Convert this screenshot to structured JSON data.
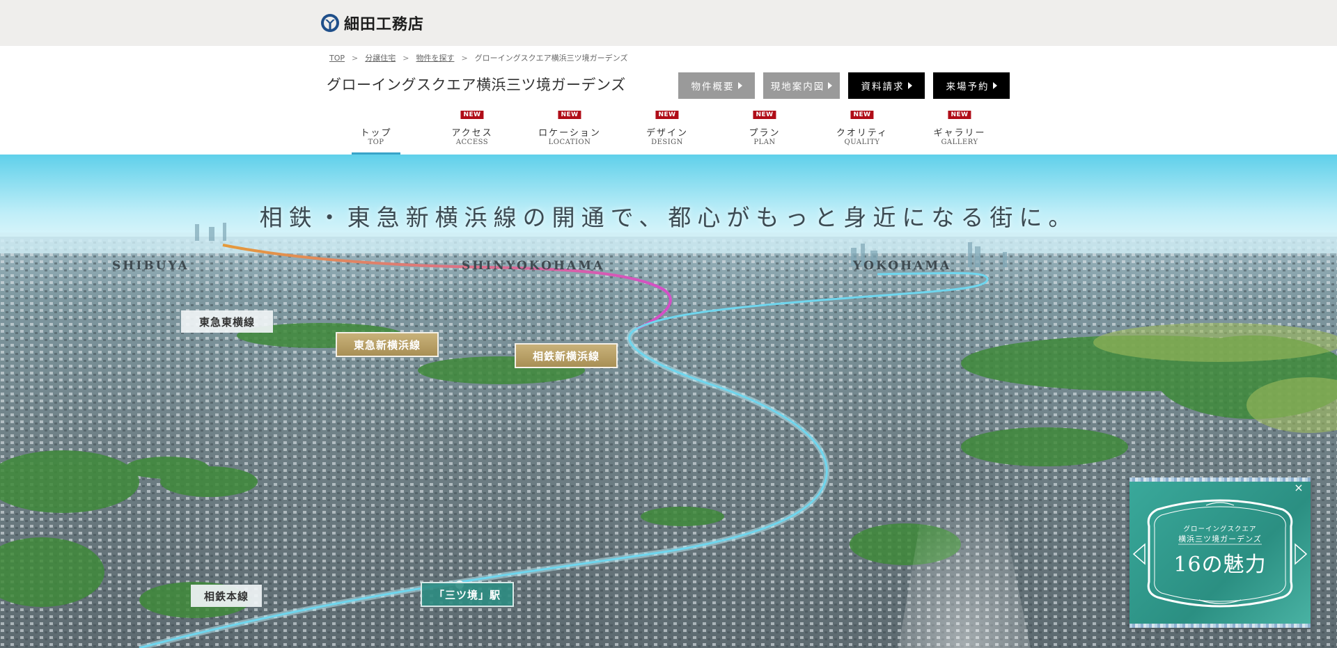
{
  "brand": {
    "name": "細田工務店"
  },
  "breadcrumb": {
    "items": [
      "TOP",
      "分譲住宅",
      "物件を探す",
      "グローイングスクエア横浜三ツ境ガーデンズ"
    ],
    "separator": ">"
  },
  "property": {
    "title": "グローイングスクエア横浜三ツ境ガーデンズ"
  },
  "header_buttons": {
    "overview": "物件概要",
    "map": "現地案内図",
    "request": "資料請求",
    "visit": "来場予約"
  },
  "nav": {
    "badge": "NEW",
    "items": [
      {
        "jp": "トップ",
        "en": "TOP",
        "is_new": false,
        "active": true
      },
      {
        "jp": "アクセス",
        "en": "ACCESS",
        "is_new": true,
        "active": false
      },
      {
        "jp": "ロケーション",
        "en": "LOCATION",
        "is_new": true,
        "active": false
      },
      {
        "jp": "デザイン",
        "en": "DESIGN",
        "is_new": true,
        "active": false
      },
      {
        "jp": "プラン",
        "en": "PLAN",
        "is_new": true,
        "active": false
      },
      {
        "jp": "クオリティ",
        "en": "QUALITY",
        "is_new": true,
        "active": false
      },
      {
        "jp": "ギャラリー",
        "en": "GALLERY",
        "is_new": true,
        "active": false
      }
    ]
  },
  "hero": {
    "headline": "相鉄・東急新横浜線の開通で、都心がもっと身近になる街に。",
    "cities": {
      "left": "SHIBUYA",
      "center": "SHINYOKOHAMA",
      "right": "YOKOHAMA"
    },
    "lines": {
      "toyoko": "東急東横線",
      "tokyu_shinyokohama": "東急新横浜線",
      "sotetsu_shinyokohama": "相鉄新横浜線",
      "sotetsu_main": "相鉄本線",
      "station": "「三ツ境」駅"
    }
  },
  "promo": {
    "subtitle": "グローイングスクエア",
    "name": "横浜三ツ境ガーデンズ",
    "main": "16の魅力",
    "close": "×"
  },
  "colors": {
    "accent_blue": "#3aa4c8",
    "new_badge": "#b00d18",
    "rail_magenta": "#d44fc8",
    "rail_orange": "#e59a3a",
    "rail_cyan": "#6fd6ee",
    "promo_teal": "#2b8f82"
  }
}
